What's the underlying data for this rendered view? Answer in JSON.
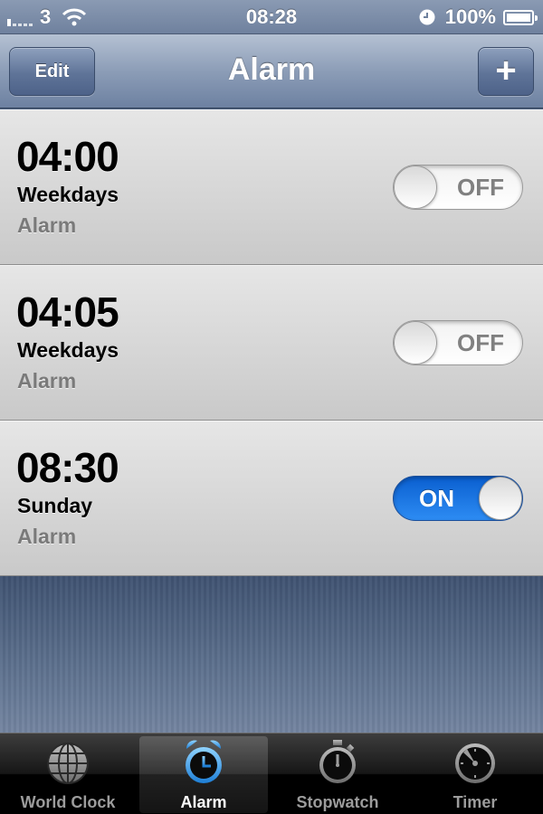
{
  "status_bar": {
    "carrier": "3",
    "time": "08:28",
    "battery": "100%",
    "icons": [
      "signal-icon",
      "wifi-icon",
      "alarm-clock-icon",
      "battery-icon"
    ]
  },
  "nav": {
    "title": "Alarm",
    "edit_label": "Edit",
    "add_label": "+"
  },
  "alarms": [
    {
      "time": "04:00",
      "days": "Weekdays",
      "label": "Alarm",
      "state": "OFF",
      "on": false
    },
    {
      "time": "04:05",
      "days": "Weekdays",
      "label": "Alarm",
      "state": "OFF",
      "on": false
    },
    {
      "time": "08:30",
      "days": "Sunday",
      "label": "Alarm",
      "state": "ON",
      "on": true
    }
  ],
  "tabs": [
    {
      "label": "World Clock",
      "icon": "globe-icon",
      "active": false
    },
    {
      "label": "Alarm",
      "icon": "alarm-clock-icon",
      "active": true
    },
    {
      "label": "Stopwatch",
      "icon": "stopwatch-icon",
      "active": false
    },
    {
      "label": "Timer",
      "icon": "timer-icon",
      "active": false
    }
  ],
  "colors": {
    "toggle_on": "#1e7ce8",
    "nav_bar": "#7c8fab",
    "active_tab_icon": "#2fa3e6"
  }
}
